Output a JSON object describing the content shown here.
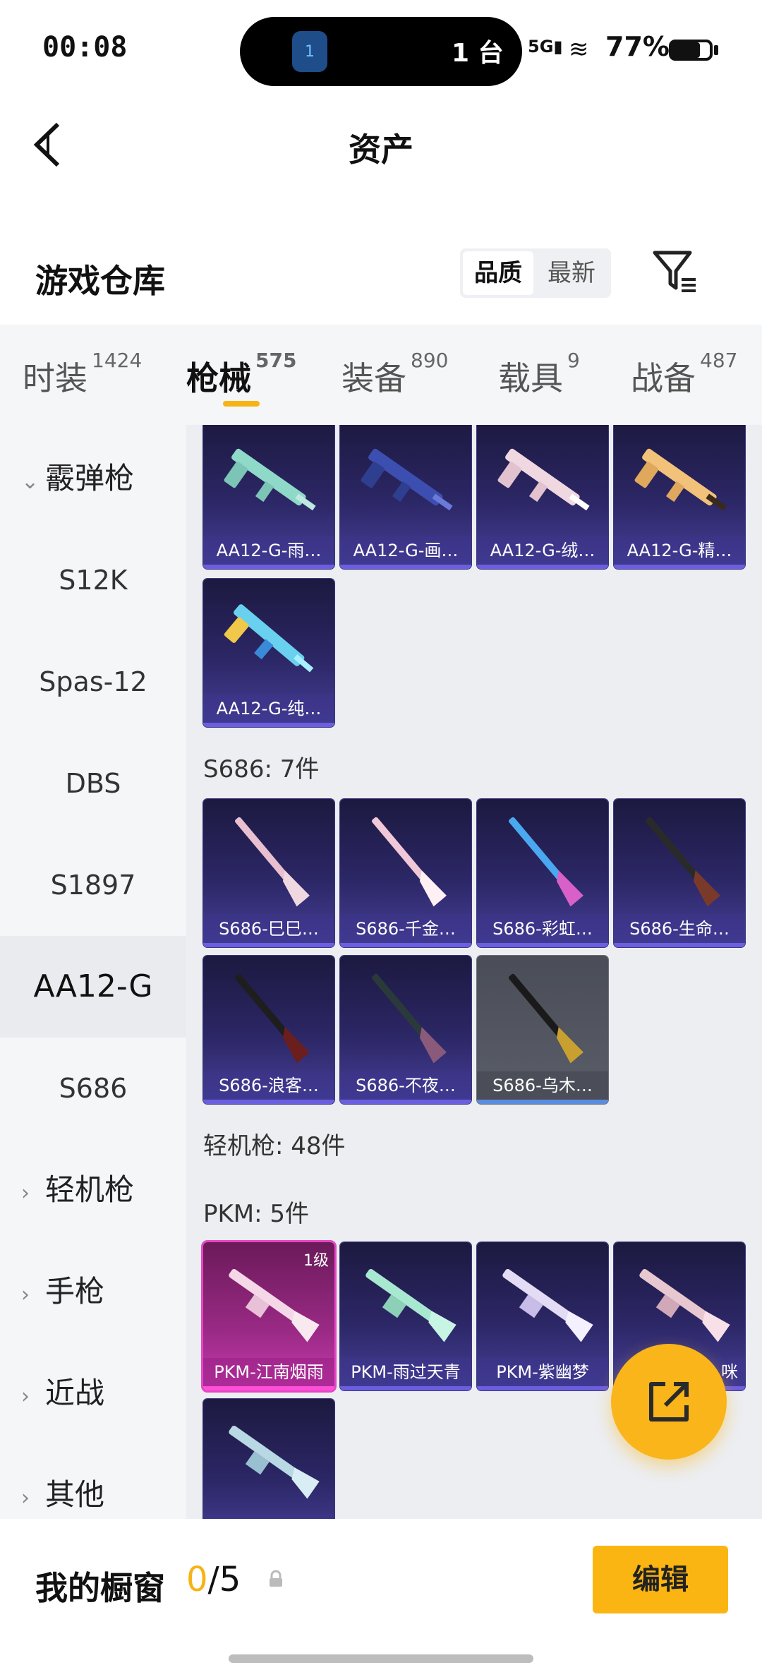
{
  "status": {
    "time": "00:08",
    "island_text": "1 台",
    "island_badge": "1",
    "signal": "5G",
    "battery": "77%"
  },
  "header": {
    "title": "资产"
  },
  "warehouse": {
    "title": "游戏仓库",
    "sort_quality": "品质",
    "sort_newest": "最新"
  },
  "tabs": [
    {
      "label": "时装",
      "count": "1424"
    },
    {
      "label": "枪械",
      "count": "575"
    },
    {
      "label": "装备",
      "count": "890"
    },
    {
      "label": "载具",
      "count": "9"
    },
    {
      "label": "战备",
      "count": "487"
    }
  ],
  "sidebar": {
    "items": [
      {
        "label": "霰弹枪",
        "type": "group",
        "expanded": true
      },
      {
        "label": "S12K",
        "type": "item"
      },
      {
        "label": "Spas-12",
        "type": "item"
      },
      {
        "label": "DBS",
        "type": "item"
      },
      {
        "label": "S1897",
        "type": "item"
      },
      {
        "label": "AA12-G",
        "type": "item",
        "active": true
      },
      {
        "label": "S686",
        "type": "item"
      },
      {
        "label": "轻机枪",
        "type": "group"
      },
      {
        "label": "手枪",
        "type": "group"
      },
      {
        "label": "近战",
        "type": "group"
      },
      {
        "label": "其他",
        "type": "group"
      }
    ]
  },
  "content": {
    "aa12_cards": [
      {
        "name": "AA12-G-雨…"
      },
      {
        "name": "AA12-G-画…"
      },
      {
        "name": "AA12-G-绒…"
      },
      {
        "name": "AA12-G-精…"
      },
      {
        "name": "AA12-G-纯…"
      }
    ],
    "s686_header": "S686: 7件",
    "s686_cards": [
      {
        "name": "S686-巳巳…"
      },
      {
        "name": "S686-千金…"
      },
      {
        "name": "S686-彩虹…"
      },
      {
        "name": "S686-生命…"
      },
      {
        "name": "S686-浪客…"
      },
      {
        "name": "S686-不夜…"
      },
      {
        "name": "S686-乌木…"
      }
    ],
    "lmg_header": "轻机枪: 48件",
    "pkm_header": "PKM: 5件",
    "pkm_cards": [
      {
        "name": "PKM-江南烟雨",
        "level": "1级"
      },
      {
        "name": "PKM-雨过天青"
      },
      {
        "name": "PKM-紫幽梦"
      },
      {
        "name": "咪"
      },
      {
        "name": ""
      }
    ]
  },
  "bottom": {
    "label": "我的橱窗",
    "count_current": "0",
    "count_total": "/5",
    "edit": "编辑"
  },
  "colors": {
    "accent": "#f7b316",
    "card_purple": "#2c2766",
    "card_gray": "#5a5e69",
    "card_pink": "#9a2a85"
  }
}
